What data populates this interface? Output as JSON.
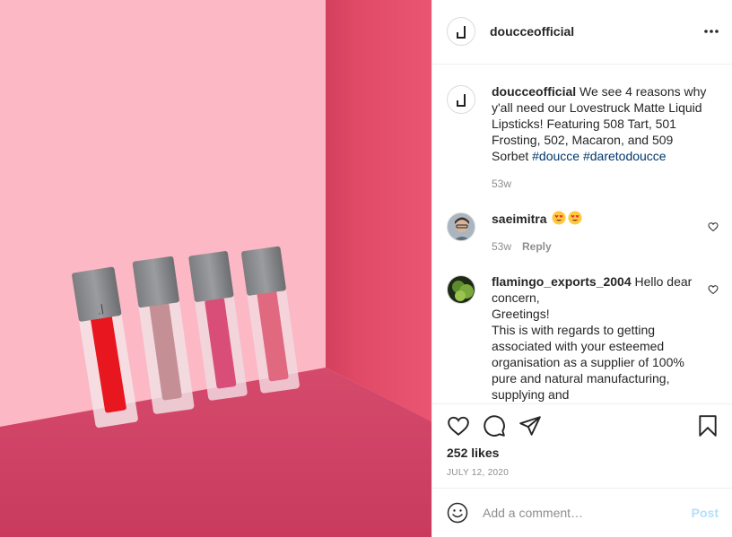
{
  "post": {
    "username": "doucceofficial",
    "more_icon": "more-horizontal-icon",
    "photo_description_icon": "post-photo",
    "logo_mark": "d",
    "caption_text": " We see 4 reasons why y'all need our Lovestruck Matte Liquid Lipsticks! Featuring 508 Tart, 501 Frosting, 502, Macaron, and 509 Sorbet ",
    "hashtags": [
      "#doucce",
      "#daretodoucce"
    ],
    "caption_age": "53w"
  },
  "comments": [
    {
      "username": "saeimitra",
      "text": "",
      "emojis": [
        "heart-eyes-emoji",
        "heart-eyes-emoji"
      ],
      "age": "53w",
      "reply_label": "Reply"
    },
    {
      "username": "flamingo_exports_2004",
      "text": " Hello dear concern,",
      "lines": [
        "Greetings!",
        "This is with regards to getting associated with your esteemed organisation as a supplier of 100% pure and natural manufacturing, supplying and"
      ]
    }
  ],
  "actions": {
    "like_icon": "heart-icon",
    "comment_icon": "comment-icon",
    "share_icon": "paper-plane-icon",
    "save_icon": "bookmark-icon",
    "likes": "252 likes",
    "date": "JULY 12, 2020"
  },
  "composer": {
    "emoji_icon": "smiley-icon",
    "placeholder": "Add a comment…",
    "post_label": "Post"
  },
  "colors": {
    "wall_left": "#fcb8c4",
    "wall_right": "#e24d68",
    "floor": "#d9466a",
    "hashtag": "#00376b",
    "post_button_disabled": "#b2dffc"
  }
}
